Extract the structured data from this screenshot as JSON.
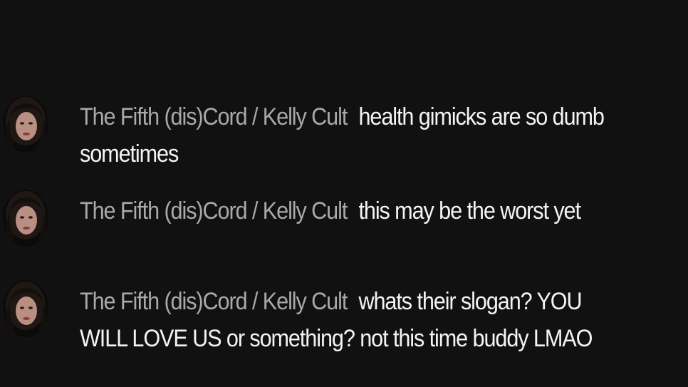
{
  "theme": {
    "background": "#111111",
    "author_color": "#a9a9a9",
    "message_color": "#f4f4f4"
  },
  "chat": {
    "messages": [
      {
        "avatar_icon": "avatar-icon",
        "author": "The Fifth (dis)Cord / Kelly Cult",
        "text": "health gimicks are so dumb sometimes"
      },
      {
        "avatar_icon": "avatar-icon",
        "author": "The Fifth (dis)Cord / Kelly Cult",
        "text": "this may be the worst yet"
      },
      {
        "avatar_icon": "avatar-icon",
        "author": "The Fifth (dis)Cord / Kelly Cult",
        "text": "whats their slogan? YOU WILL LOVE US or something? not this time buddy LMAO"
      }
    ]
  }
}
